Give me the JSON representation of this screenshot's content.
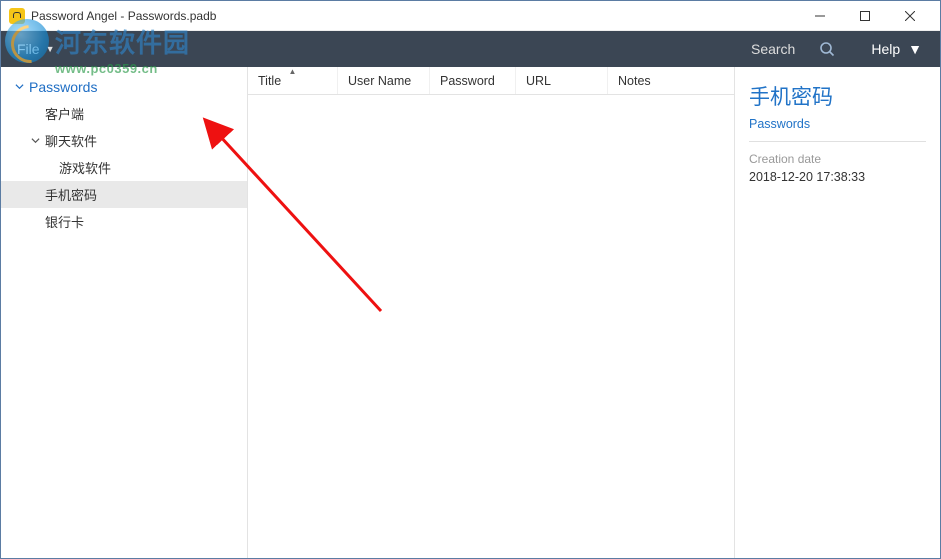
{
  "window": {
    "title": "Password Angel - Passwords.padb"
  },
  "menubar": {
    "file": "File",
    "search_label": "Search",
    "help": "Help"
  },
  "sidebar": {
    "root_label": "Passwords",
    "items": [
      {
        "label": "客户端",
        "indent": 1,
        "expandable": false
      },
      {
        "label": "聊天软件",
        "indent": 1,
        "expandable": true
      },
      {
        "label": "游戏软件",
        "indent": 2,
        "expandable": false
      },
      {
        "label": "手机密码",
        "indent": 1,
        "expandable": false,
        "selected": true
      },
      {
        "label": "银行卡",
        "indent": 1,
        "expandable": false
      }
    ]
  },
  "list": {
    "columns": {
      "title": "Title",
      "username": "User Name",
      "password": "Password",
      "url": "URL",
      "notes": "Notes"
    }
  },
  "detail": {
    "title": "手机密码",
    "subtitle": "Passwords",
    "creation_label": "Creation date",
    "creation_value": "2018-12-20 17:38:33"
  },
  "watermark": {
    "name": "河东软件园",
    "url": "www.pc0359.cn"
  }
}
